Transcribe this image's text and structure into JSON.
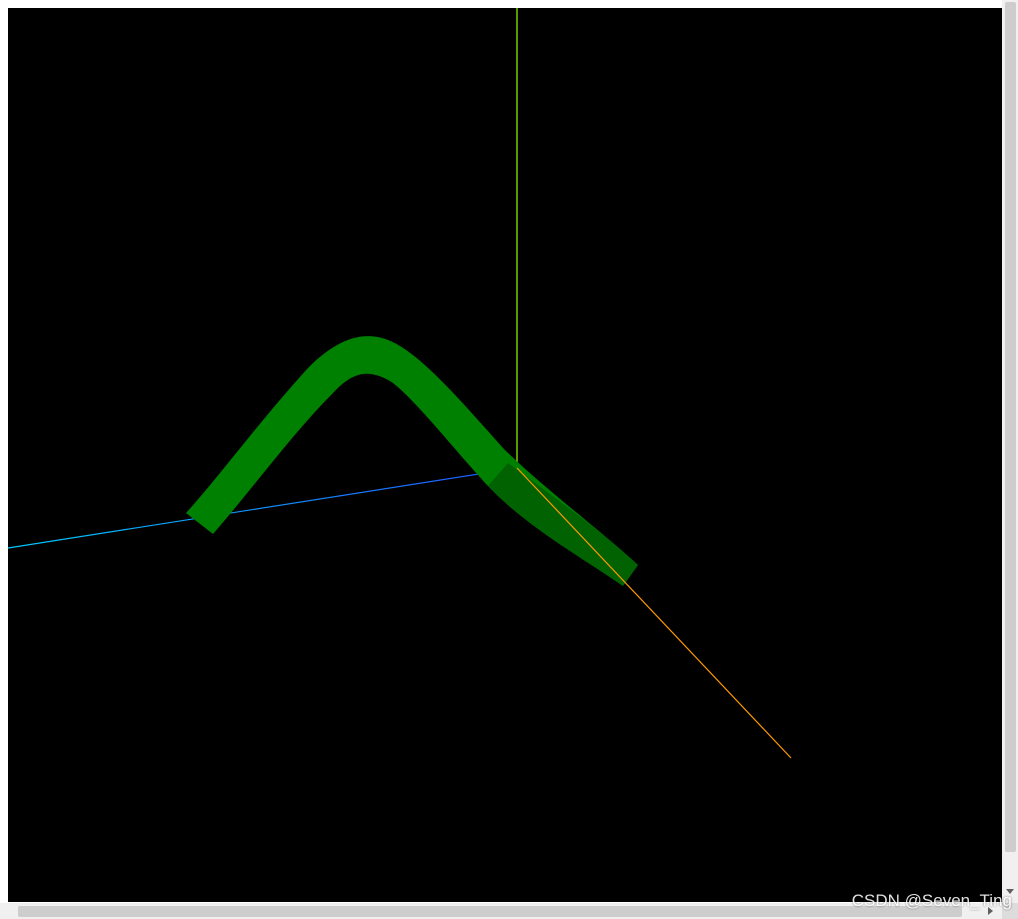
{
  "scene": {
    "background": "#000000",
    "axes": {
      "x_color": "#ff9900",
      "y_color": "#99ff00",
      "z_color": "#0099ff"
    },
    "tube_color": "#008000",
    "tube_dark_color": "#005e00"
  },
  "watermark": {
    "text": "CSDN @Seven_Ting"
  }
}
